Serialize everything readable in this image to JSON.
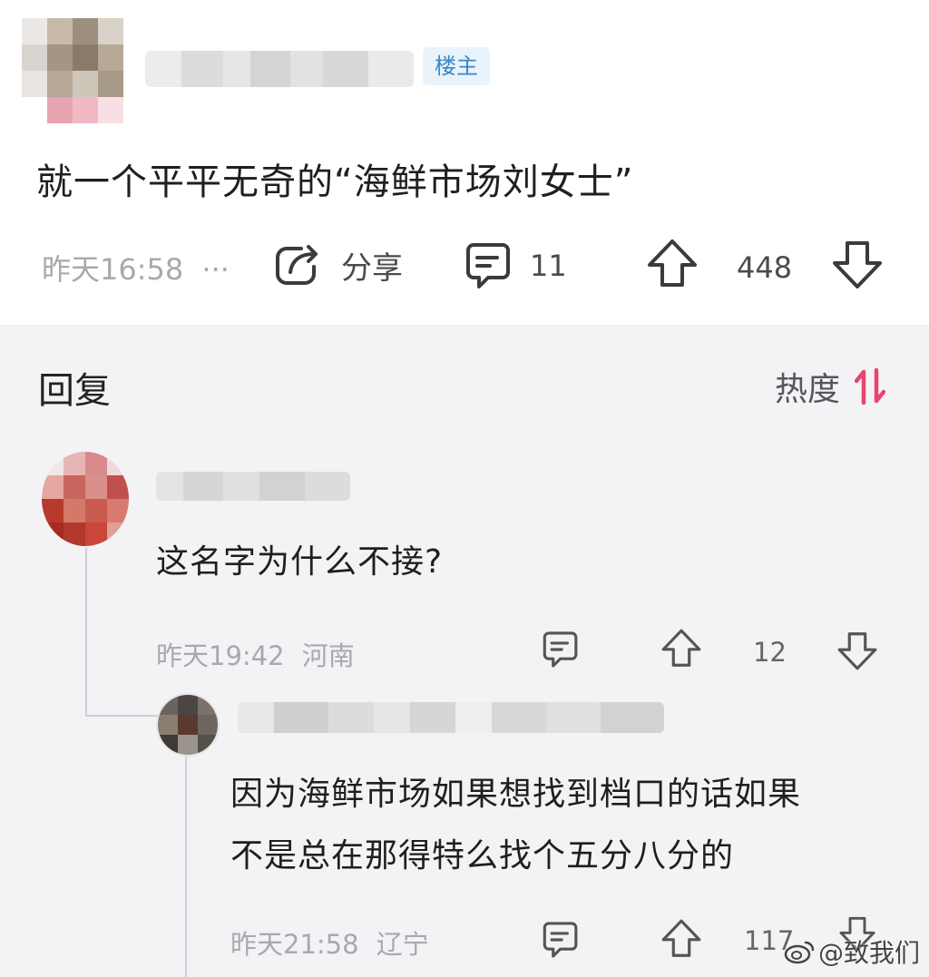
{
  "post": {
    "op_badge": "楼主",
    "content": "就一个平平无奇的“海鲜市场刘女士”",
    "time": "昨天16:58",
    "more": "···",
    "share_label": "分享",
    "comment_count": "11",
    "upvotes": "448"
  },
  "replies": {
    "title": "回复",
    "sort_label": "热度",
    "sort_color": "#e8456f",
    "comments": [
      {
        "text": "这名字为什么不接?",
        "time": "昨天19:42",
        "location": "河南",
        "upvotes": "12"
      },
      {
        "text_line1": "因为海鲜市场如果想找到档口的话如果",
        "text_line2": "不是总在那得特么找个五分八分的",
        "time": "昨天21:58",
        "location": "辽宁",
        "upvotes": "117"
      }
    ]
  },
  "watermark": "@致我们"
}
